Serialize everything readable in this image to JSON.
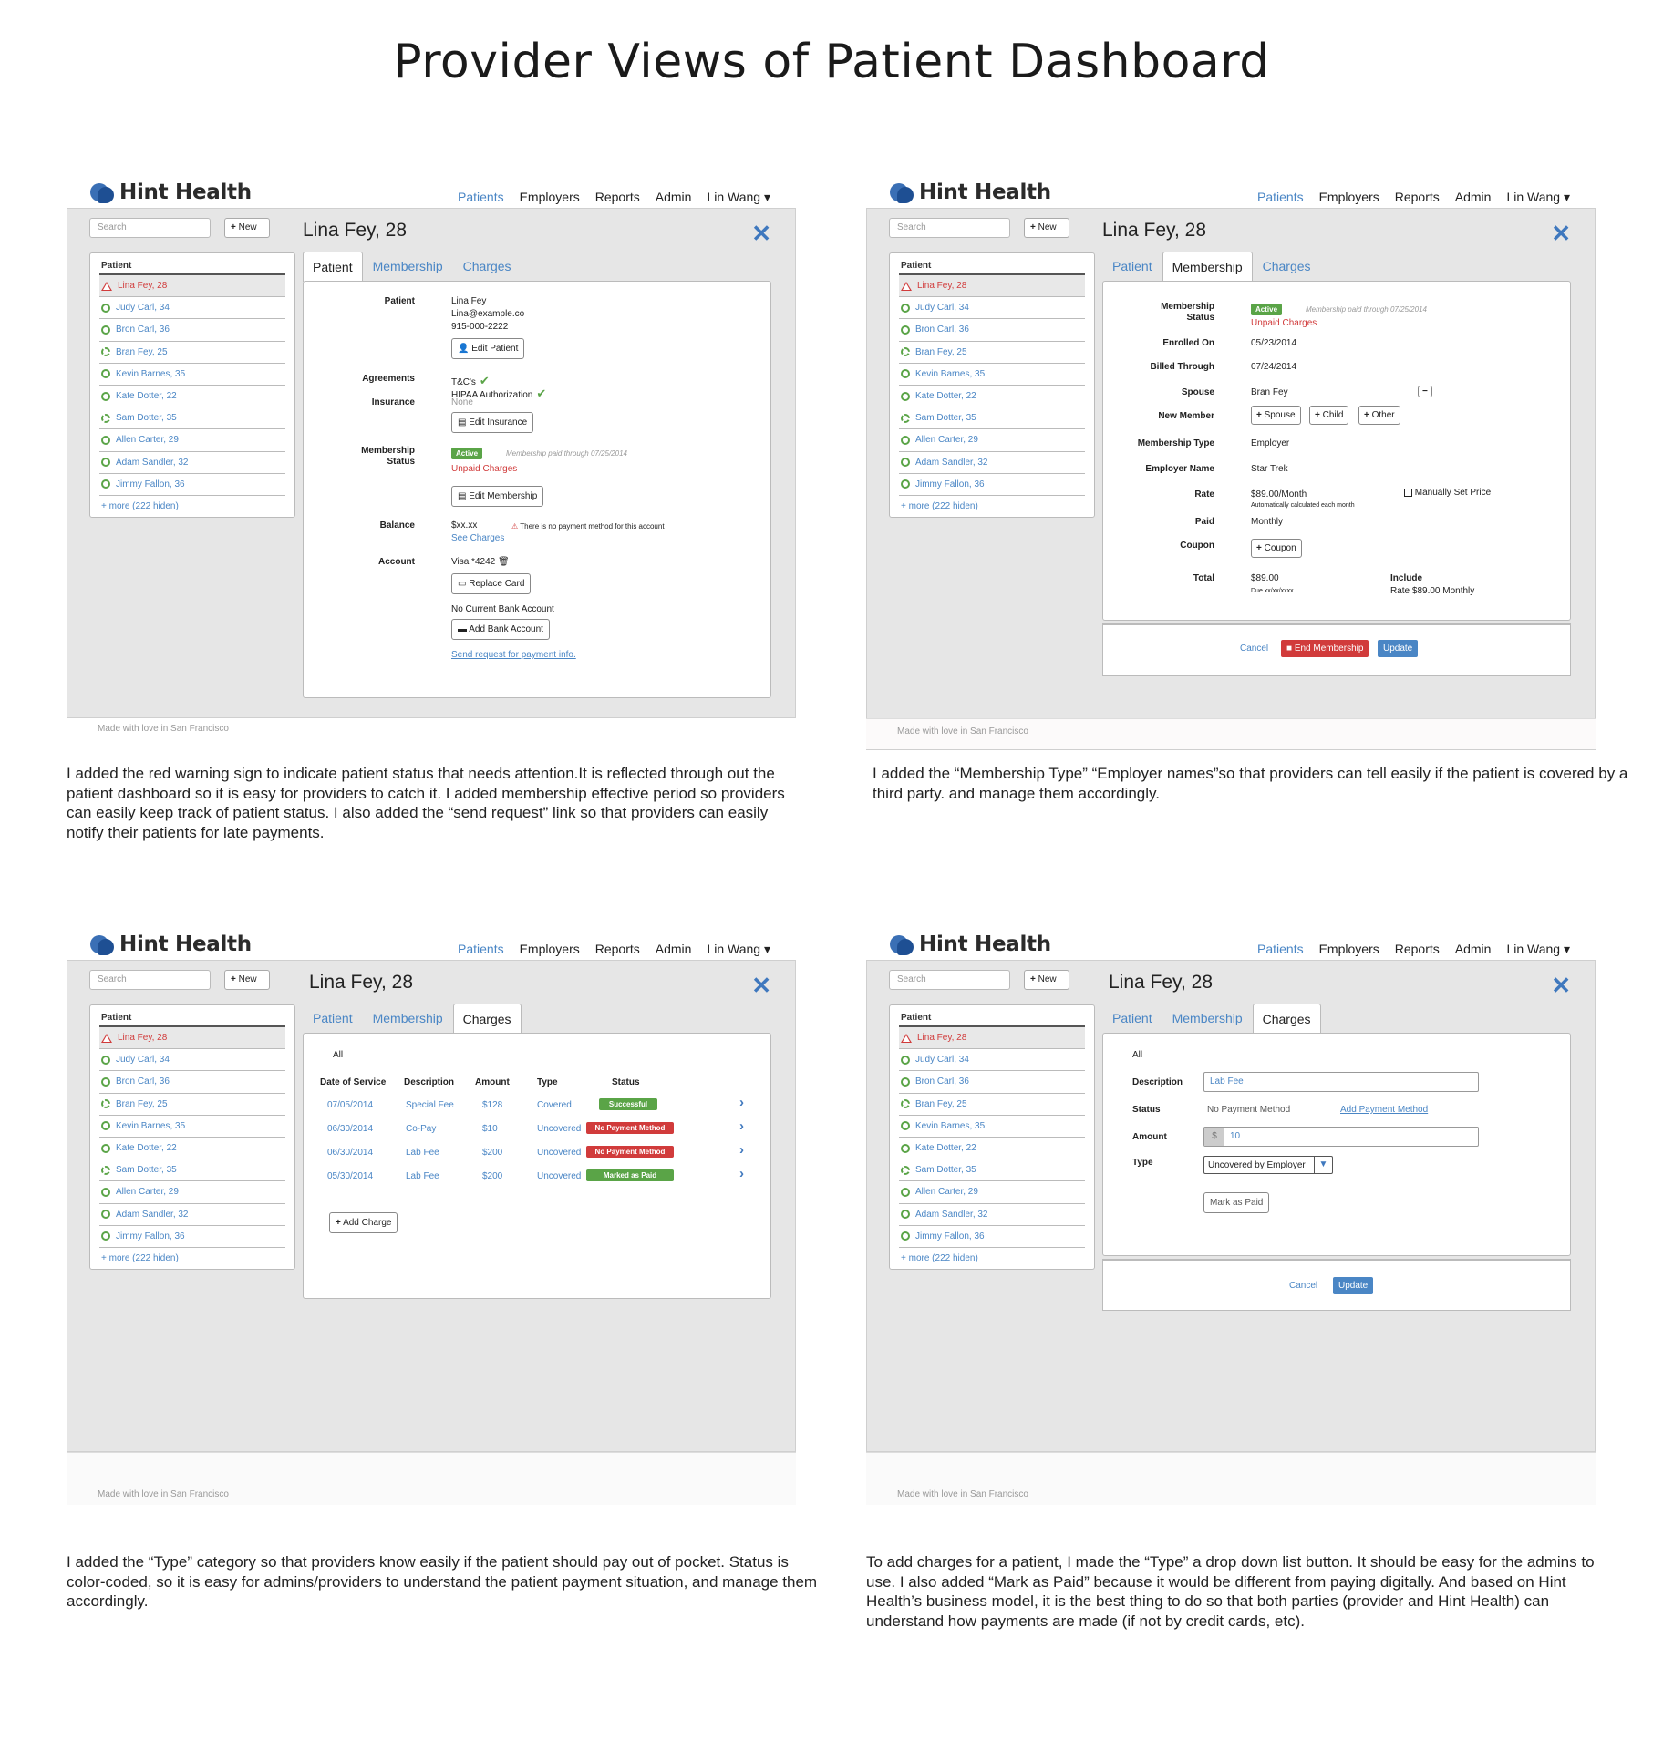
{
  "page": {
    "title": "Provider Views of Patient Dashboard"
  },
  "app": {
    "logo": "Hint Health",
    "nav": [
      "Patients",
      "Employers",
      "Reports",
      "Admin",
      "Lin Wang ▾"
    ],
    "search_placeholder": "Search",
    "new_label": "New",
    "list_header": "Patient",
    "patients": [
      "Lina Fey, 28",
      "Judy Carl, 34",
      "Bron Carl, 36",
      "Bran Fey, 25",
      "Kevin Barnes, 35",
      "Kate Dotter, 22",
      "Sam Dotter, 35",
      "Allen Carter, 29",
      "Adam Sandler, 32",
      "Jimmy Fallon, 36"
    ],
    "more": "+ more (222 hiden)",
    "patient_title": "Lina Fey, 28",
    "tabs": [
      "Patient",
      "Membership",
      "Charges"
    ],
    "footer": "Made with love in San Francisco"
  },
  "panel1": {
    "patient_label": "Patient",
    "patient_name": "Lina Fey",
    "email": "Lina@example.co",
    "phone": "915-000-2222",
    "edit_patient": "Edit Patient",
    "agreements_label": "Agreements",
    "agreement_1": "T&C's",
    "agreement_2": "HIPAA Authorization",
    "insurance_label": "Insurance",
    "insurance_value": "None",
    "edit_insurance": "Edit Insurance",
    "membership_label_1": "Membership",
    "membership_label_2": "Status",
    "active": "Active",
    "paid_through": "Membership paid through  07/25/2014",
    "unpaid": "Unpaid Charges",
    "edit_membership": "Edit Membership",
    "balance_label": "Balance",
    "balance_value": "$xx.xx",
    "no_payment_warning": "There is no payment method for this account",
    "see_charges": "See Charges",
    "account_label": "Account",
    "card": "Visa *4242",
    "replace_card": "Replace Card",
    "no_bank": "No Current Bank Account",
    "add_bank": "Add Bank Account",
    "send_request": "Send request for payment info.",
    "caption": "I added the red warning sign to indicate patient status that needs attention.It is reflected through out the patient dashboard so it is easy for providers to catch it. I added membership effective period so providers can easily keep track of patient status. I also added the “send request” link so that providers can easily notify their patients for late payments."
  },
  "panel2": {
    "status_l1": "Membership",
    "status_l2": "Status",
    "active": "Active",
    "paid_through": "Membership paid through  07/25/2014",
    "unpaid": "Unpaid Charges",
    "enrolled_label": "Enrolled On",
    "enrolled_value": "05/23/2014",
    "billed_label": "Billed Through",
    "billed_value": "07/24/2014",
    "spouse_label": "Spouse",
    "spouse_value": "Bran Fey",
    "new_member_label": "New Member",
    "new_spouse": "Spouse",
    "new_child": "Child",
    "new_other": "Other",
    "type_label": "Membership Type",
    "type_value": "Employer",
    "employer_label": "Employer Name",
    "employer_value": "Star Trek",
    "rate_label": "Rate",
    "rate_value": "$89.00/Month",
    "rate_note": "Automatically calculated each month",
    "manual_price": "Manually Set Price",
    "paid_label": "Paid",
    "paid_value": "Monthly",
    "coupon_label": "Coupon",
    "coupon_btn": "Coupon",
    "total_label": "Total",
    "total_value": "$89.00",
    "due": "Due xx/xx/xxxx",
    "include_label": "Include",
    "include_value": "Rate  $89.00 Monthly",
    "cancel": "Cancel",
    "end_membership": "End Membership",
    "update": "Update",
    "caption": "I added the “Membership Type” “Employer names”so that providers can tell easily if the patient is covered by a third party. and manage them accordingly."
  },
  "panel3": {
    "filter": "All",
    "headers": [
      "Date of Service",
      "Description",
      "Amount",
      "Type",
      "Status"
    ],
    "rows": [
      {
        "date": "07/05/2014",
        "desc": "Special Fee",
        "amount": "$128",
        "type": "Covered",
        "status": "Successful",
        "color": "#5aa447"
      },
      {
        "date": "06/30/2014",
        "desc": "Co-Pay",
        "amount": "$10",
        "type": "Uncovered",
        "status": "No Payment Method",
        "color": "#d13b3b"
      },
      {
        "date": "06/30/2014",
        "desc": "Lab Fee",
        "amount": "$200",
        "type": "Uncovered",
        "status": "No Payment Method",
        "color": "#d13b3b"
      },
      {
        "date": "05/30/2014",
        "desc": "Lab Fee",
        "amount": "$200",
        "type": "Uncovered",
        "status": "Marked as Paid",
        "color": "#5aa447"
      }
    ],
    "add_charge": "Add Charge",
    "caption": "I added the “Type” category so that providers know easily if the patient should pay out of pocket. Status is color-coded, so it is easy for admins/providers to understand the patient payment situation, and manage them accordingly."
  },
  "panel4": {
    "filter": "All",
    "desc_label": "Description",
    "desc_value": "Lab Fee",
    "status_label": "Status",
    "status_value": "No Payment Method",
    "add_payment": "Add Payment Method",
    "amount_label": "Amount",
    "currency": "$",
    "amount_value": "10",
    "type_label": "Type",
    "type_value": "Uncovered by Employer",
    "mark_paid": "Mark as Paid",
    "cancel": "Cancel",
    "update": "Update",
    "caption": "To add charges for a patient, I made the “Type” a drop down list button. It should be easy for the admins to use. I also added “Mark as Paid” because it would be different from paying digitally. And based on Hint Health’s business model, it is the best thing to do so that both parties (provider and Hint Health) can understand how payments are made (if not by credit cards, etc)."
  }
}
